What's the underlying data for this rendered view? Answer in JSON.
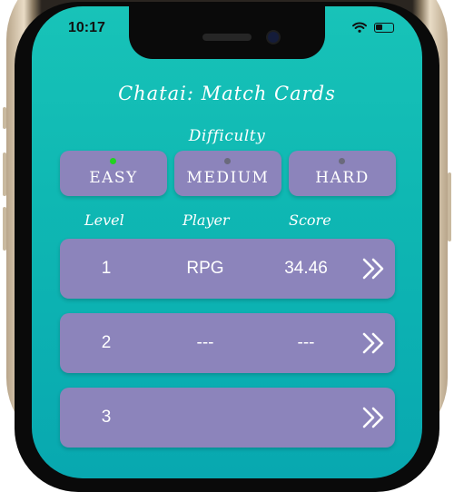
{
  "status_bar": {
    "time": "10:17",
    "icons": [
      "wifi-icon",
      "battery-icon"
    ]
  },
  "app": {
    "title": "Chatai: Match Cards"
  },
  "difficulty": {
    "label": "Difficulty",
    "options": [
      {
        "label": "EASY",
        "selected": true
      },
      {
        "label": "MEDIUM",
        "selected": false
      },
      {
        "label": "HARD",
        "selected": false
      }
    ]
  },
  "table": {
    "headers": [
      "Level",
      "Player",
      "Score"
    ],
    "rows": [
      {
        "level": "1",
        "player": "RPG",
        "score": "34.46",
        "action_icon": "double-chevron-right-icon"
      },
      {
        "level": "2",
        "player": "---",
        "score": "---",
        "action_icon": "double-chevron-right-icon"
      },
      {
        "level": "3",
        "player": "",
        "score": "",
        "action_icon": "double-chevron-right-icon"
      }
    ]
  },
  "colors": {
    "background_top": "#18c3b8",
    "background_bottom": "#08a8b0",
    "card": "#8c84bb",
    "selected_indicator": "#22d321",
    "unselected_indicator": "#6a6a7c",
    "text": "#ffffff"
  }
}
